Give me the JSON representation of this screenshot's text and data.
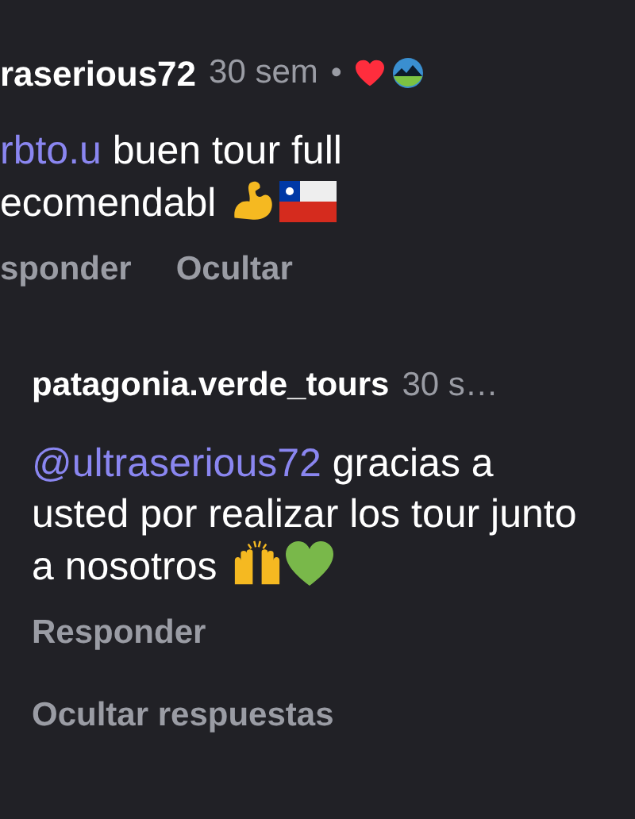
{
  "comments": [
    {
      "author": "raserious72",
      "time": "30 sem",
      "separator": "•",
      "liked_by_author": true,
      "mention": "rbto.u",
      "text": "buen tour full ecomendabl",
      "emojis": [
        {
          "kind": "muscle"
        },
        {
          "kind": "chile_flag"
        }
      ],
      "actions": [
        "sponder",
        "Ocultar"
      ],
      "replies": [
        {
          "author": "patagonia.verde_tours",
          "time": "30 s…",
          "liked_by_author": false,
          "mention": "@ultraserious72",
          "text": "gracias a usted por realizar los tour junto a nosotros",
          "emojis": [
            {
              "kind": "raised_hands"
            },
            {
              "kind": "green_heart"
            }
          ],
          "actions": [
            "Responder"
          ]
        }
      ],
      "replies_toggle": "Ocultar respuestas"
    }
  ]
}
